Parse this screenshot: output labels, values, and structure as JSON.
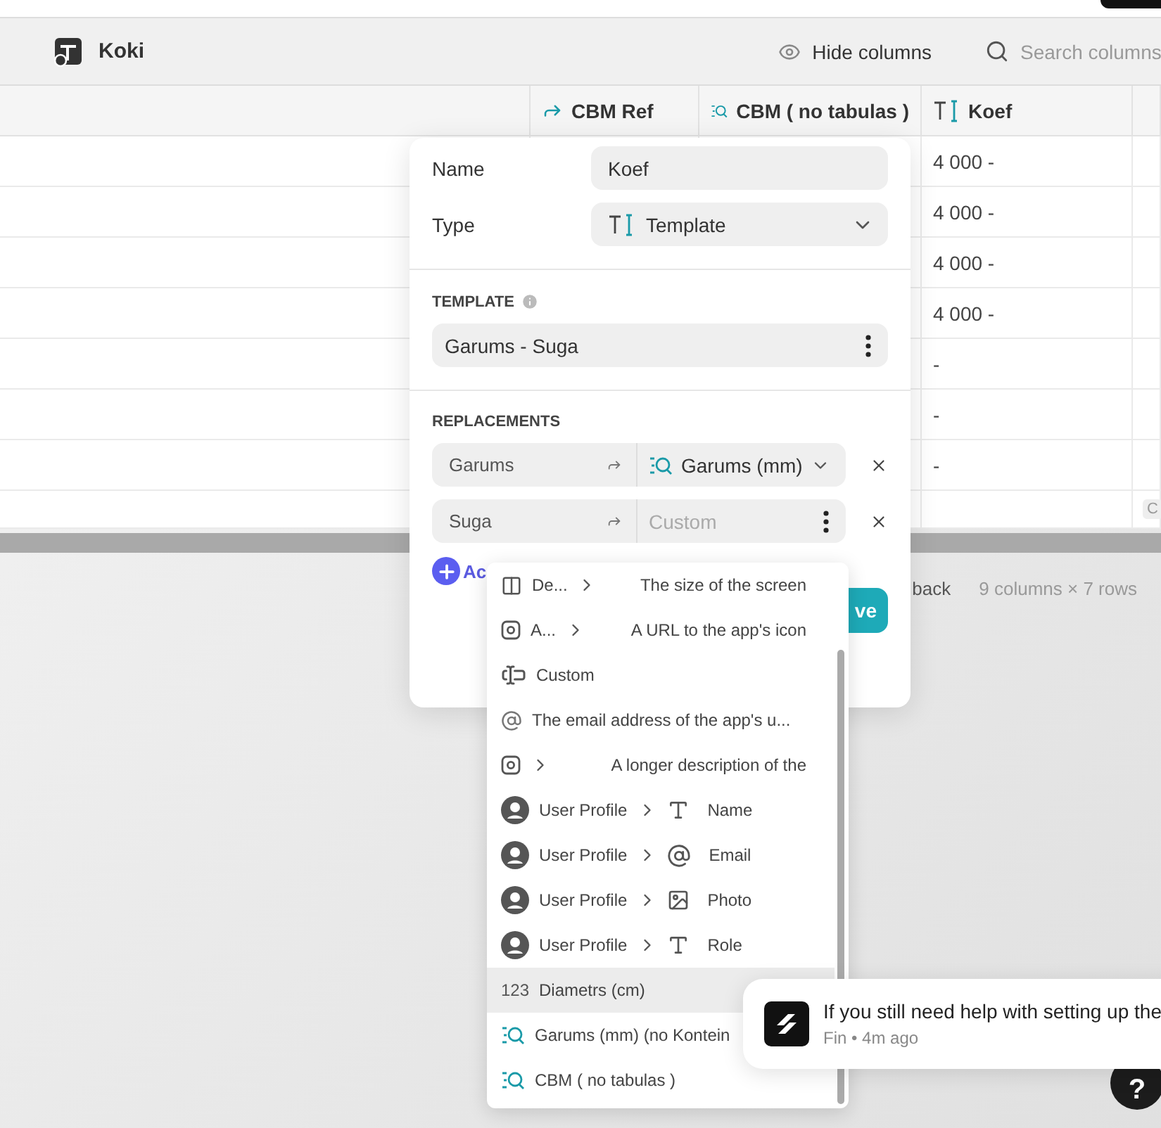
{
  "app_bar": {
    "title": "Koki"
  },
  "toolbar": {
    "hide_columns": "Hide columns",
    "search": {
      "placeholder": "Search columns"
    }
  },
  "table": {
    "columns": [
      {
        "kind": "plain"
      },
      {
        "label": "CBM Ref",
        "kind": "relation"
      },
      {
        "label": "CBM ( no tabulas )",
        "kind": "lookup"
      },
      {
        "label": "Koef",
        "kind": "template"
      }
    ],
    "rows": [
      {
        "koef": "4 000 -"
      },
      {
        "koef": "4 000 -"
      },
      {
        "koef": "4 000 -"
      },
      {
        "koef": "4 000 -"
      },
      {
        "koef": "-"
      },
      {
        "koef": "-"
      },
      {
        "koef": "-"
      }
    ],
    "add_row_chip": "C"
  },
  "footer": {
    "back": "back",
    "summary": "9 columns × 7 rows"
  },
  "column_editor": {
    "name_label": "Name",
    "name_value": "Koef",
    "type_label": "Type",
    "type_value": "Template",
    "template_heading": "TEMPLATE",
    "template_value": "Garums - Suga",
    "replacements_heading": "REPLACEMENTS",
    "replacements": [
      {
        "key": "Garums",
        "kind": "column",
        "value": "Garums (mm)"
      },
      {
        "key": "Suga",
        "kind": "custom",
        "placeholder": "Custom"
      }
    ],
    "add_label": "Ac",
    "save_label": "ve"
  },
  "value_menu": {
    "items": [
      {
        "kind": "device",
        "label": "De...",
        "description": "The size of the screen",
        "selected": false
      },
      {
        "kind": "app",
        "label": "A...",
        "description": "A URL to the app's icon",
        "selected": false
      },
      {
        "kind": "custom",
        "label": "Custom",
        "selected": false
      },
      {
        "kind": "email",
        "label": "The email address of the app's u...",
        "selected": false
      },
      {
        "kind": "app",
        "description": "A longer description of the",
        "selected": false
      },
      {
        "kind": "user_field",
        "label": "User Profile",
        "field": {
          "kind": "text",
          "label": "Name"
        },
        "selected": false
      },
      {
        "kind": "user_field",
        "label": "User Profile",
        "field": {
          "kind": "email",
          "label": "Email"
        },
        "selected": false
      },
      {
        "kind": "user_field",
        "label": "User Profile",
        "field": {
          "kind": "image",
          "label": "Photo"
        },
        "selected": false
      },
      {
        "kind": "user_field",
        "label": "User Profile",
        "field": {
          "kind": "text",
          "label": "Role"
        },
        "selected": false
      },
      {
        "kind": "number",
        "icon_text": "123",
        "label": "Diametrs (cm)",
        "selected": true
      },
      {
        "kind": "lookup",
        "label": "Garums (mm) (no Kontein",
        "selected": false
      },
      {
        "kind": "lookup",
        "label": "CBM ( no tabulas )",
        "selected": false
      }
    ]
  },
  "toast": {
    "message": "If you still need help with setting up the",
    "meta": "Fin • 4m ago"
  },
  "help": {
    "label": "?"
  }
}
